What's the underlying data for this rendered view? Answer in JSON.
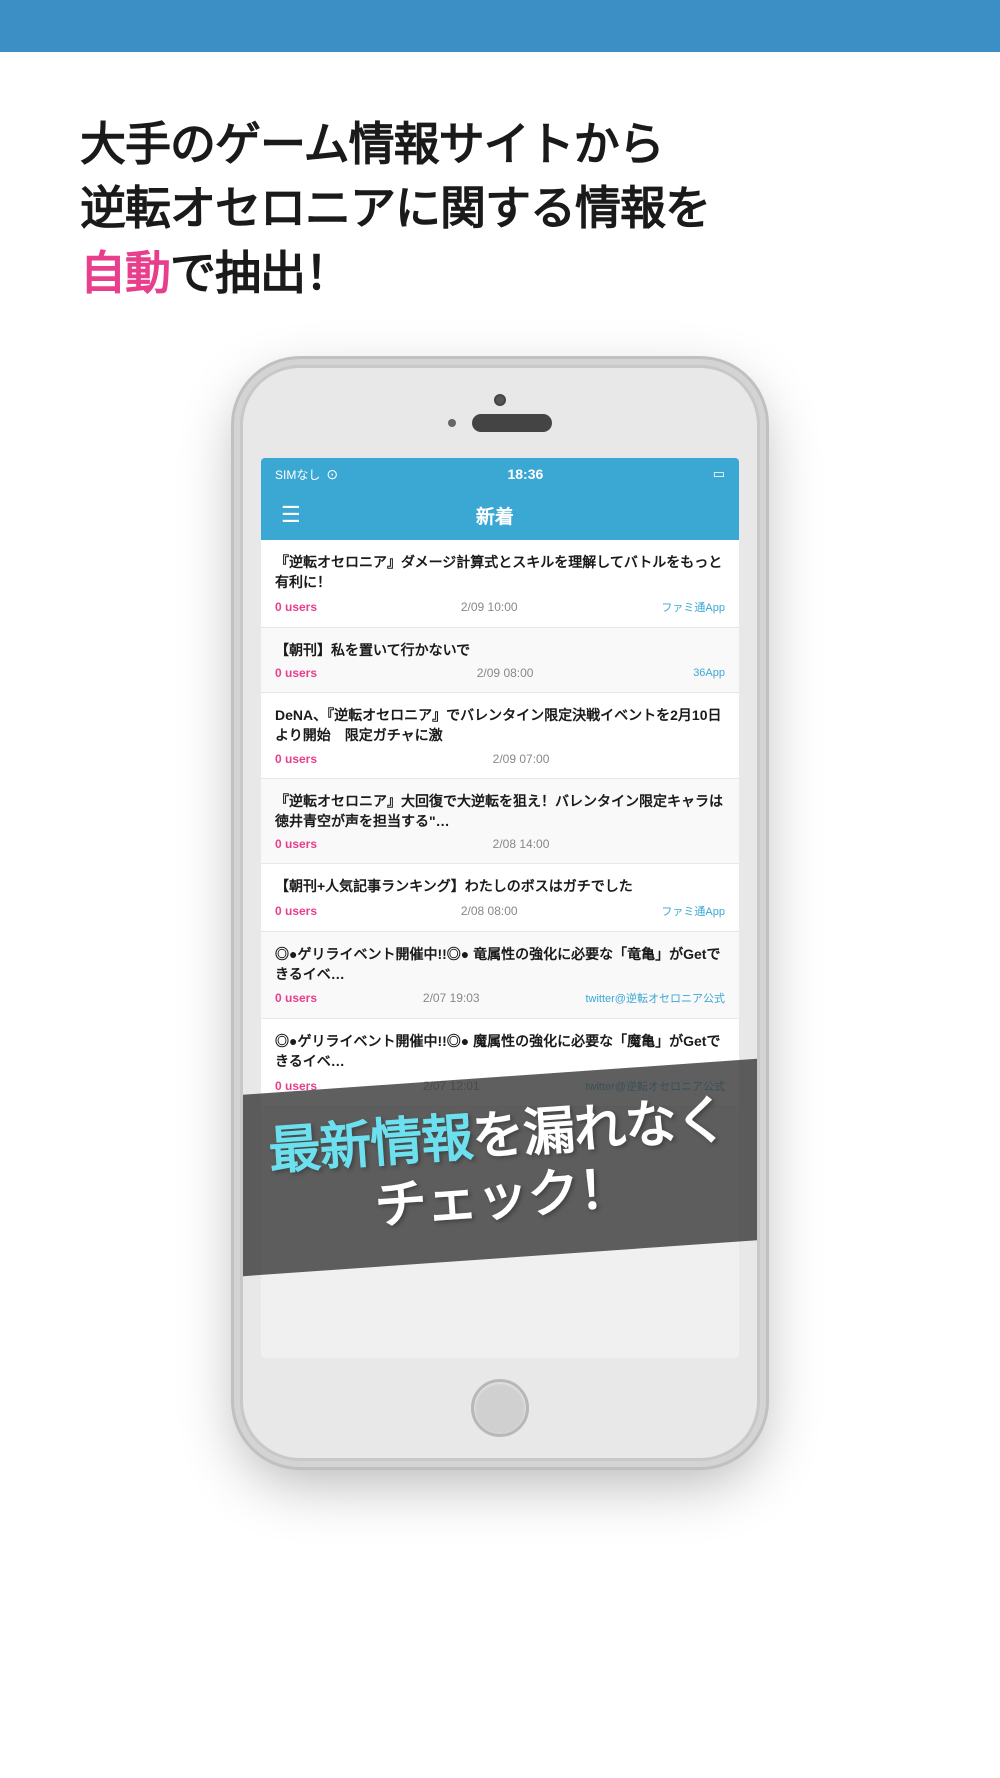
{
  "topBar": {
    "color": "#3b8fc4"
  },
  "hero": {
    "line1": "大手のゲーム情報サイトから",
    "line2": "逆転オセロニアに関する情報を",
    "line3_prefix": "",
    "line3_highlight": "自動",
    "line3_suffix": "で抽出！"
  },
  "phone": {
    "statusBar": {
      "carrier": "SIMなし",
      "wifi": "〒",
      "time": "18:36",
      "battery": "🔋"
    },
    "navBar": {
      "title": "新着"
    },
    "newsItems": [
      {
        "title": "『逆転オセロニア』ダメージ計算式とスキルを理解してバトルをもっと有利に！",
        "users": "0 users",
        "date": "2/09 10:00",
        "source": "ファミ通App"
      },
      {
        "title": "【朝刊】私を置いて行かないで",
        "users": "0 users",
        "date": "2/09 08:00",
        "source": "36App"
      },
      {
        "title": "DeNA、『逆転オセロニア』でバレンタイン限定決戦イベントを2月10日より開始　限定ガチャに激",
        "users": "0 users",
        "date": "2/09 07:00",
        "source": ""
      },
      {
        "title": "『逆転オセロニア』大回復で大逆転を狙え！バレンタイン限定キャラは徳井青空が声を担当する\"…",
        "users": "0 users",
        "date": "2/08 14:00",
        "source": ""
      },
      {
        "title": "【朝刊+人気記事ランキング】わたしのボスはガチでした",
        "users": "0 users",
        "date": "2/08 08:00",
        "source": "ファミ通App"
      },
      {
        "title": "◎●ゲリライベント開催中!!◎●\n竜属性の強化に必要な「竜亀」がGetできるイベ…",
        "users": "0 users",
        "date": "2/07 19:03",
        "source": "twitter@逆転オセロニア公式"
      },
      {
        "title": "◎●ゲリライベント開催中!!◎●\n魔属性の強化に必要な「魔亀」がGetできるイベ…",
        "users": "0 users",
        "date": "2/07 12:01",
        "source": "twitter@逆転オセロニア公式"
      }
    ]
  },
  "overlay": {
    "prefix_highlight": "最新情報",
    "suffix": "を漏れなくチェック！"
  }
}
